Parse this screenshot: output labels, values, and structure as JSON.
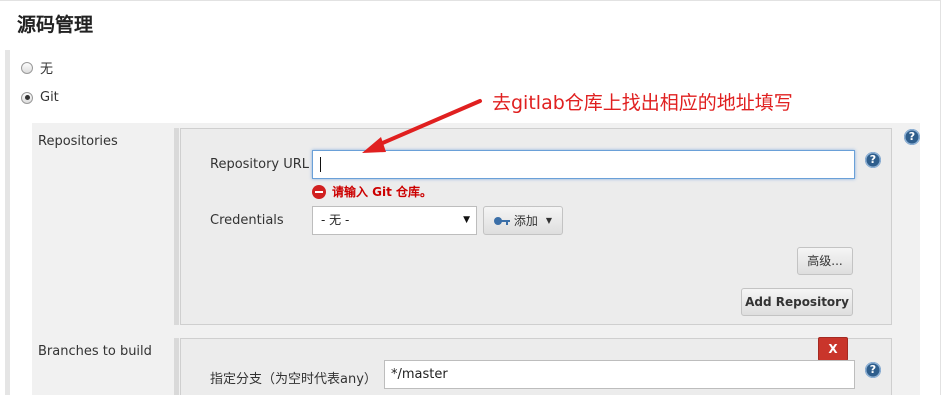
{
  "section": {
    "title": "源码管理"
  },
  "scm_options": [
    {
      "label": "无",
      "checked": false
    },
    {
      "label": "Git",
      "checked": true
    }
  ],
  "repositories": {
    "label": "Repositories",
    "url_label": "Repository URL",
    "url_value": "",
    "error_text": "请输入 Git 仓库。",
    "credentials_label": "Credentials",
    "credentials_selected": "- 无 -",
    "add_button": "添加",
    "advanced_button": "高级...",
    "add_repository_button": "Add Repository"
  },
  "branches": {
    "label": "Branches to build",
    "delete_button": "X",
    "specifier_label": "指定分支（为空时代表any）",
    "specifier_value": "*/master"
  },
  "help_glyph": "?",
  "annotation": {
    "text": "去gitlab仓库上找出相应的地址填写",
    "color": "#e02020"
  },
  "colors": {
    "error": "#cc0000",
    "help_icon": "#2f5e8c",
    "delete_button": "#c9352b"
  }
}
